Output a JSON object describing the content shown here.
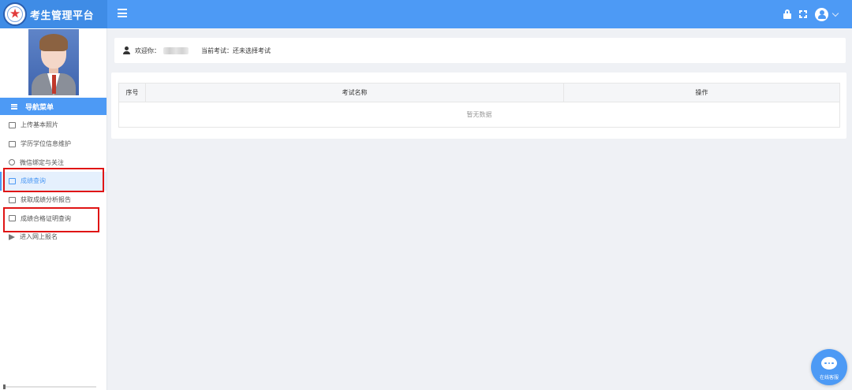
{
  "header": {
    "title": "考生管理平台",
    "logo_icon": "star-emblem-icon",
    "menu_icon": "hamburger-menu-icon",
    "right_icons": [
      "lock-icon",
      "fullscreen-icon",
      "user-avatar-icon",
      "chevron-down-icon"
    ]
  },
  "sidebar": {
    "nav_title": "导航菜单",
    "items": [
      {
        "label": "上传基本照片",
        "icon": "image-icon",
        "active": false
      },
      {
        "label": "学历学位信息维护",
        "icon": "book-icon",
        "active": false
      },
      {
        "label": "微信绑定与关注",
        "icon": "wechat-icon",
        "active": false
      },
      {
        "label": "成绩查询",
        "icon": "document-icon",
        "active": true
      },
      {
        "label": "获取成绩分析报告",
        "icon": "report-icon",
        "active": false
      },
      {
        "label": "成绩合格证明查询",
        "icon": "certificate-icon",
        "active": false
      },
      {
        "label": "进入网上报名",
        "icon": "send-icon",
        "active": false
      }
    ]
  },
  "welcome": {
    "greeting": "欢迎你：",
    "current_exam_label": "当前考试：",
    "current_exam_value": "还未选择考试"
  },
  "table": {
    "columns": [
      "序号",
      "考试名称",
      "操作"
    ],
    "empty_text": "暂无数据"
  },
  "chat": {
    "label": "在线客服"
  },
  "colors": {
    "primary": "#4d9af5",
    "highlight": "#e01515",
    "background": "#eff1f5"
  }
}
